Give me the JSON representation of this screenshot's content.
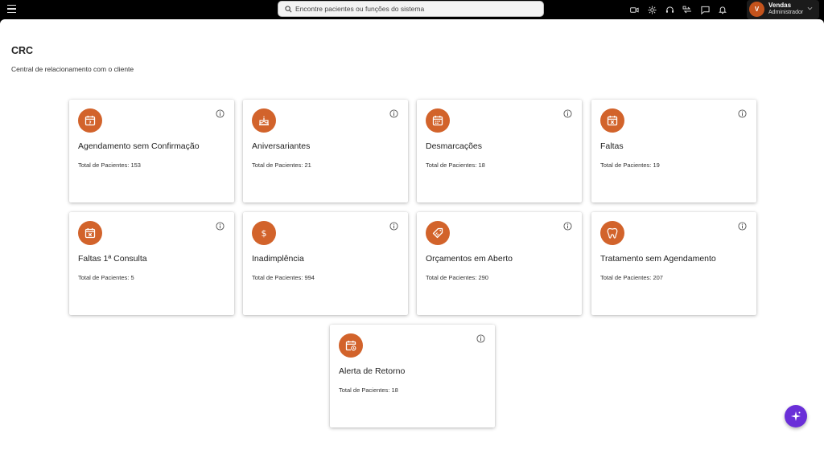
{
  "search": {
    "placeholder": "Encontre pacientes ou funções do sistema"
  },
  "toolbar": {
    "icons": [
      "video-icon",
      "sparkle-icon",
      "headset-icon",
      "sync-icon",
      "chat-icon",
      "bell-icon"
    ]
  },
  "user": {
    "initial": "V",
    "name": "Vendas",
    "role": "Administrador"
  },
  "page": {
    "title": "CRC",
    "subtitle": "Central de relacionamento com o cliente"
  },
  "colors": {
    "accent": "#d2632b",
    "fab": "#6a2fd8"
  },
  "cards": [
    {
      "title": "Agendamento sem Confirmação",
      "total": "Total de Pacientes: 153",
      "icon": "calendar-question-icon"
    },
    {
      "title": "Aniversariantes",
      "total": "Total de Pacientes: 21",
      "icon": "cake-icon"
    },
    {
      "title": "Desmarcações",
      "total": "Total de Pacientes: 18",
      "icon": "calendar-icon"
    },
    {
      "title": "Faltas",
      "total": "Total de Pacientes: 19",
      "icon": "calendar-x-icon"
    },
    {
      "title": "Faltas 1ª Consulta",
      "total": "Total de Pacientes: 5",
      "icon": "calendar-x-icon"
    },
    {
      "title": "Inadimplência",
      "total": "Total de Pacientes: 994",
      "icon": "dollar-icon"
    },
    {
      "title": "Orçamentos em Aberto",
      "total": "Total de Pacientes: 290",
      "icon": "tag-icon"
    },
    {
      "title": "Tratamento sem Agendamento",
      "total": "Total de Pacientes: 207",
      "icon": "tooth-icon"
    },
    {
      "title": "Alerta de Retorno",
      "total": "Total de Pacientes: 18",
      "icon": "calendar-clock-icon"
    }
  ]
}
